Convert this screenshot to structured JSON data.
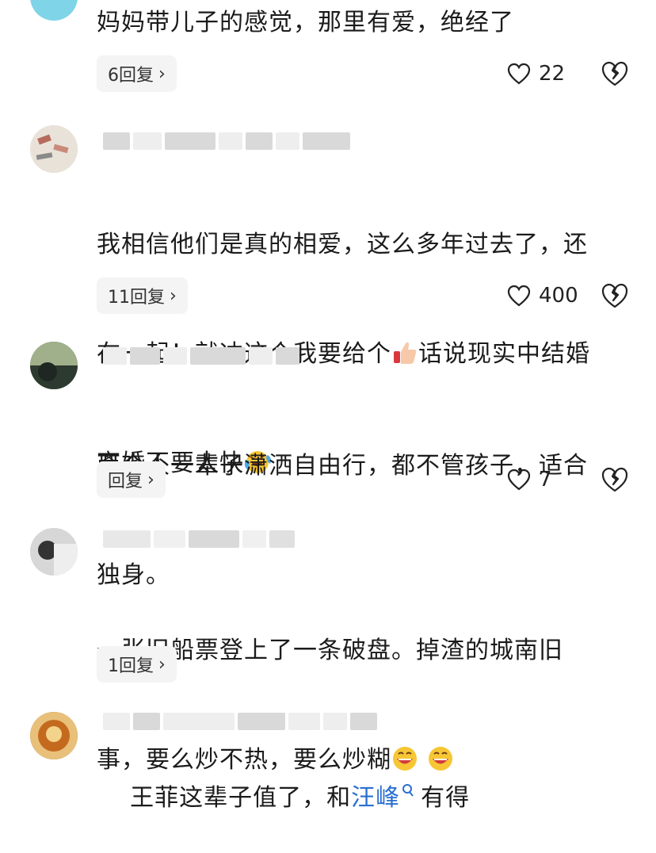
{
  "comments": [
    {
      "text": "妈妈带儿子的感觉，那里有爱，绝经了",
      "reply_label": "6回复",
      "likes": "22"
    },
    {
      "text_line1": "我相信他们是真的相爱，这么多年过去了，还",
      "text_line2a": "在一起！就冲这个我要给个",
      "text_line2b": "话说现实中结婚",
      "text_line3": "离婚不要太快",
      "reply_label": "11回复",
      "likes": "400"
    },
    {
      "text_line1": "两个人一辈子潇洒自由行，都不管孩子，适合",
      "text_line2": "独身。",
      "reply_label": "回复",
      "likes": "7"
    },
    {
      "text_line1": "一张旧船票登上了一条破盘。掉渣的城南旧",
      "text_line2": "事，要么炒不热，要么炒糊",
      "reply_label": "1回复"
    },
    {
      "text_before": "王菲这辈子值了，和",
      "mention": "汪峰",
      "text_after": "有得"
    }
  ],
  "icons": {
    "like": "heart-outline-icon",
    "dislike": "broken-heart-icon",
    "reply_chevron": "chevron-right-icon",
    "search": "search-icon",
    "thumbs_up_emoji": "thumbs-up-emoji",
    "laugh_cry_emoji": "laughing-crying-emoji",
    "grin_emoji": "grinning-emoji"
  },
  "colors": {
    "mention": "#2a6fd0",
    "reply_bg": "#f4f4f4"
  }
}
